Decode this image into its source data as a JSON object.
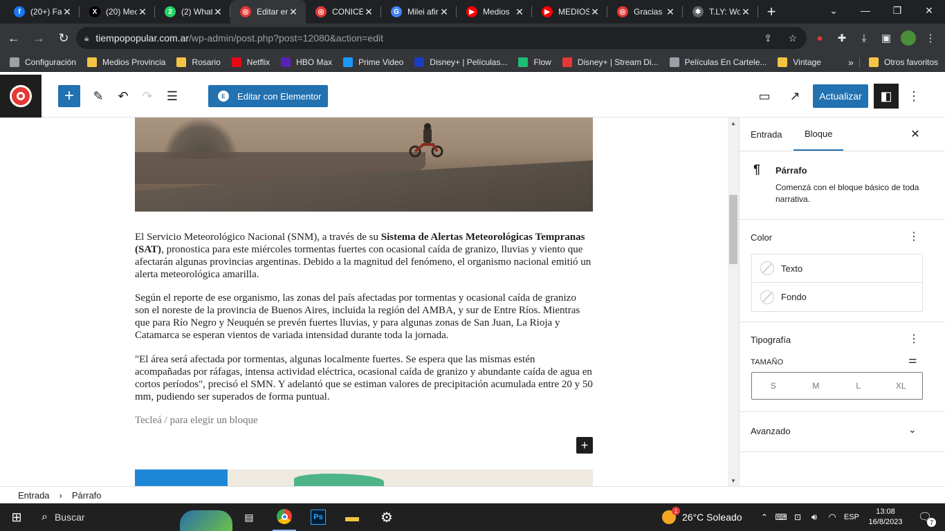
{
  "browser": {
    "tabs": [
      {
        "title": "(20+) Fa",
        "icon": "facebook-icon",
        "color": "#1877f2",
        "glyph": "f"
      },
      {
        "title": "(20) Mec",
        "icon": "x-icon",
        "color": "#000000",
        "glyph": "X"
      },
      {
        "title": "(2) What",
        "icon": "whatsapp-icon",
        "color": "#25d366",
        "glyph": "2"
      },
      {
        "title": "Editar en",
        "icon": "site-icon",
        "color": "#e53935",
        "glyph": "◎",
        "active": true
      },
      {
        "title": "CONICE",
        "icon": "site-icon",
        "color": "#e53935",
        "glyph": "◎"
      },
      {
        "title": "Milei afir",
        "icon": "g-icon",
        "color": "#4285f4",
        "glyph": "G"
      },
      {
        "title": "Medios",
        "icon": "youtube-icon",
        "color": "#ff0000",
        "glyph": "▶"
      },
      {
        "title": "MEDIOS",
        "icon": "youtube-icon",
        "color": "#ff0000",
        "glyph": "▶"
      },
      {
        "title": "Gracias",
        "icon": "site-icon",
        "color": "#e53935",
        "glyph": "◎"
      },
      {
        "title": "T.LY: Wo",
        "icon": "tly-icon",
        "color": "#5f6368",
        "glyph": "✱"
      }
    ],
    "new_tab": "+",
    "url_host": "tiempopopular.com.ar",
    "url_path": "/wp-admin/post.php?post=12080&action=edit",
    "bookmarks": [
      {
        "label": "Configuración",
        "icon": "globe-icon",
        "color": "#9aa0a6"
      },
      {
        "label": "Medios Provincia",
        "icon": "folder-icon",
        "color": "#f4c542"
      },
      {
        "label": "Rosario",
        "icon": "folder-icon",
        "color": "#f4c542"
      },
      {
        "label": "Netflix",
        "icon": "netflix-icon",
        "color": "#e50914"
      },
      {
        "label": "HBO Max",
        "icon": "hbo-icon",
        "color": "#5822b4"
      },
      {
        "label": "Prime Video",
        "icon": "prime-icon",
        "color": "#1a98ff"
      },
      {
        "label": "Disney+ | Películas...",
        "icon": "disney-icon",
        "color": "#1a3cbf"
      },
      {
        "label": "Flow",
        "icon": "flow-icon",
        "color": "#1dbf73"
      },
      {
        "label": "Disney+ | Stream Di...",
        "icon": "star-icon",
        "color": "#e53935"
      },
      {
        "label": "Películas En Cartele...",
        "icon": "grid-icon",
        "color": "#9aa0a6"
      },
      {
        "label": "Vintage",
        "icon": "folder-icon",
        "color": "#f4c542"
      }
    ],
    "more_bookmarks": "»",
    "other_favorites": "Otros favoritos"
  },
  "editor": {
    "elementor_label": "Editar con Elementor",
    "update_label": "Actualizar",
    "paragraphs": [
      {
        "html": "El Servicio Meteorológico Nacional (SNM), a través de su <b>Sistema de Alertas Meteorológicas Tempranas (SAT)</b>, pronostica para este miércoles tormentas fuertes con ocasional caída de granizo, lluvias y viento que afectarán algunas provincias argentinas. Debido a la magnitud del fenómeno, el organismo nacional emitió un alerta meteorológica amarilla."
      },
      {
        "html": "Según el reporte de ese organismo, las zonas del país afectadas por tormentas y ocasional caída de granizo son el noreste de la provincia de Buenos Aires, incluida la región del AMBA, y sur de Entre Ríos. Mientras que para Río Negro y Neuquén se prevén fuertes lluvias, y para algunas zonas de San Juan, La Rioja y Catamarca se esperan vientos de variada intensidad durante toda la jornada."
      },
      {
        "html": "\"El área será afectada por tormentas, algunas localmente fuertes. Se espera que las mismas estén acompañadas por ráfagas, intensa actividad eléctrica, ocasional caída de granizo y abundante caída de agua en cortos períodos\", precisó el SMN. Y adelantó que se estiman valores de precipitación acumulada entre 20 y 50 mm, pudiendo ser superados de forma puntual."
      }
    ],
    "placeholder": "Tecleá / para elegir un bloque"
  },
  "sidebar": {
    "tab_entrada": "Entrada",
    "tab_bloque": "Bloque",
    "block_name": "Párrafo",
    "block_desc": "Comenzá con el bloque básico de toda narrativa.",
    "color_title": "Color",
    "color_text": "Texto",
    "color_background": "Fondo",
    "typography_title": "Tipografía",
    "size_label": "TAMAÑO",
    "sizes": [
      "S",
      "M",
      "L",
      "XL"
    ],
    "advanced_title": "Avanzado"
  },
  "breadcrumb": {
    "root": "Entrada",
    "sep": "›",
    "current": "Párrafo"
  },
  "taskbar": {
    "search_label": "Buscar",
    "weather": "26°C  Soleado",
    "weather_badge": "1",
    "language": "ESP",
    "time": "13:08",
    "date": "16/8/2023",
    "notifications": "7"
  },
  "colors": {
    "accent": "#2271b1",
    "chrome_dark": "#202124",
    "chrome_toolbar": "#35363a"
  }
}
